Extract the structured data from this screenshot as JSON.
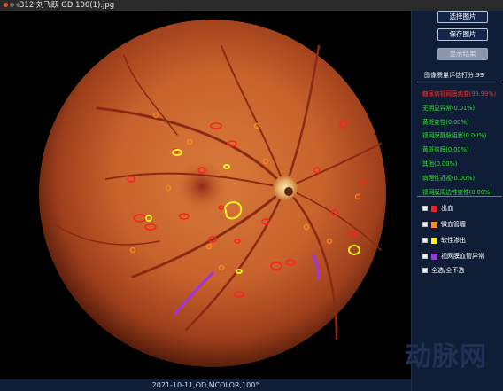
{
  "window": {
    "title": "312 刘飞跃 OD 100(1).jpg"
  },
  "image_caption": "2021-10-11,OD,MCOLOR,100°",
  "panel": {
    "buttons": {
      "select_image": "选择图片",
      "save_image": "保存图片",
      "show_result": "显示结果"
    },
    "quality_score": "图像质量评估打分:99",
    "diagnoses": [
      {
        "label": "糖尿病视网膜病变(99.99%)",
        "color": "#ff2a2a"
      },
      {
        "label": "无明显异常(0.01%)",
        "color": "#2ee02e"
      },
      {
        "label": "黄斑变性(0.00%)",
        "color": "#2ee02e"
      },
      {
        "label": "视网膜静脉阻塞(0.00%)",
        "color": "#2ee02e"
      },
      {
        "label": "黄斑前膜(0.00%)",
        "color": "#2ee02e"
      },
      {
        "label": "其他(0.00%)",
        "color": "#2ee02e"
      },
      {
        "label": "病理性近视(0.00%)",
        "color": "#2ee02e"
      },
      {
        "label": "视网膜周边性变性(0.00%)",
        "color": "#2ee02e"
      }
    ],
    "legend": [
      {
        "label": "出血",
        "color": "#ff2020"
      },
      {
        "label": "微血管瘤",
        "color": "#ff8c1a"
      },
      {
        "label": "软性渗出",
        "color": "#f5f02a"
      },
      {
        "label": "视网膜血管异常",
        "color": "#a233e6"
      }
    ],
    "select_all": "全选/全不选",
    "watermark": "动脉网"
  }
}
